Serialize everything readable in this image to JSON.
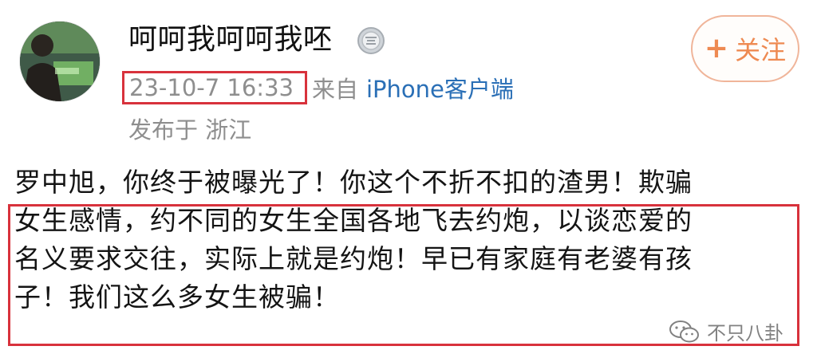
{
  "post": {
    "username": "呵呵我呵呵我呸",
    "badge_icon": "silver-medal-badge-icon",
    "follow": {
      "plus": "+",
      "label": "关注"
    },
    "timestamp": "23-10-7 16:33",
    "from_label": "来自",
    "source": "iPhone客户端",
    "location": "发布于 浙江",
    "text_lines": [
      "罗中旭，你终于被曝光了！你这个不折不扣的渣男！欺骗",
      "女生感情，约不同的女生全国各地飞去约炮，以谈恋爱的",
      "名义要求交往，实际上就是约炮！早已有家庭有老婆有孩",
      "子！我们这么多女生被骗！"
    ]
  },
  "watermark": {
    "icon": "wechat-icon",
    "text": "不只八卦"
  },
  "colors": {
    "highlight_border": "#d8323c",
    "follow_accent": "#ee8a52",
    "source_link": "#2a6fb6",
    "meta_gray": "#8e8e8e"
  }
}
